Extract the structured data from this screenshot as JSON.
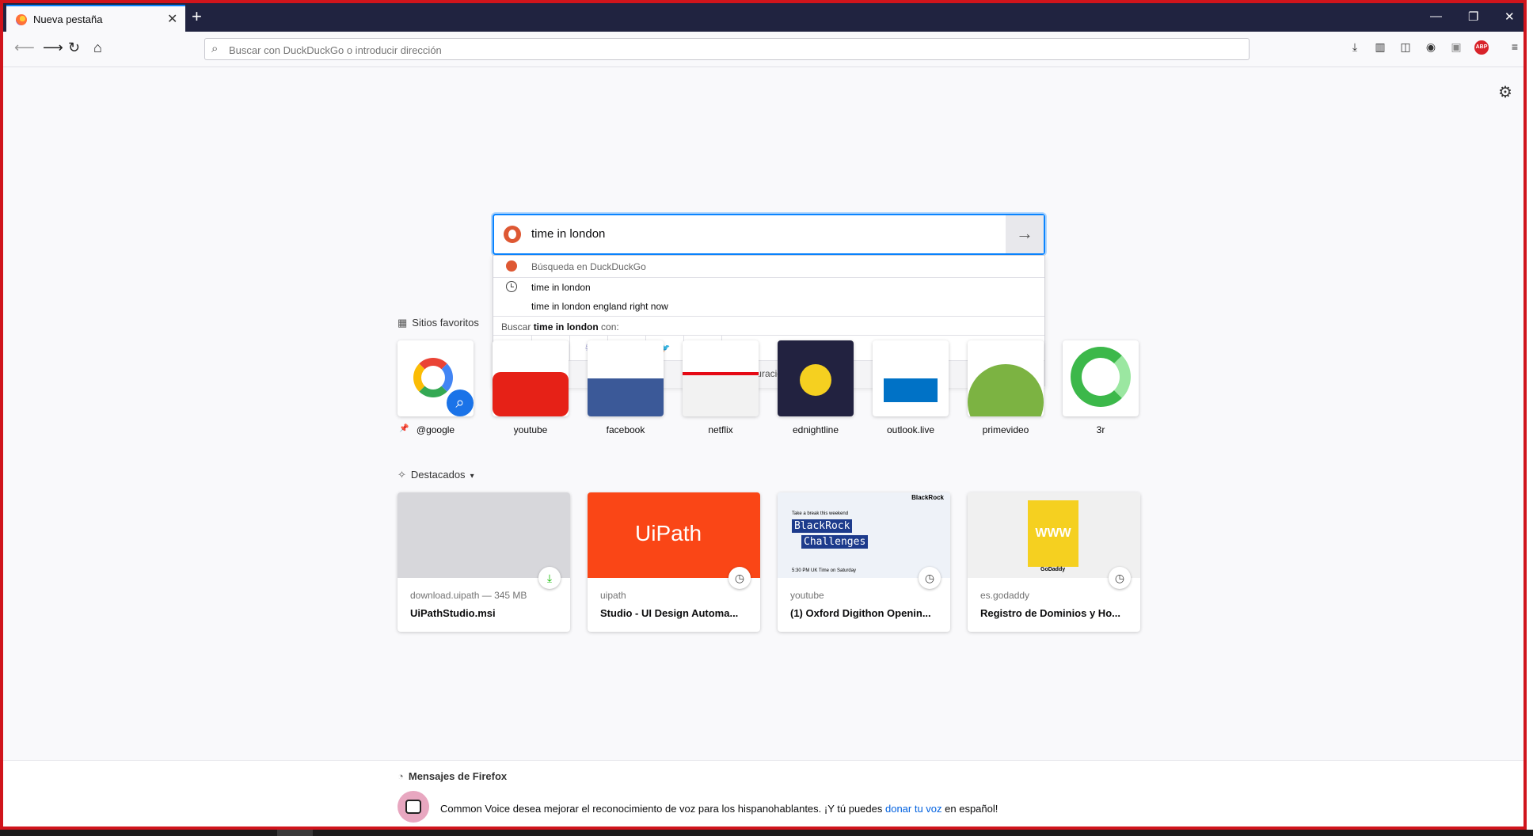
{
  "tab": {
    "title": "Nueva pestaña",
    "close": "✕",
    "new": "+"
  },
  "window_controls": {
    "minimize": "—",
    "restore": "❐",
    "close": "✕"
  },
  "toolbar": {
    "url_placeholder": "Buscar con DuckDuckGo o introducir dirección",
    "abp_label": "ABP"
  },
  "search": {
    "query": "time in london",
    "dropdown": {
      "header": "Búsqueda en DuckDuckGo",
      "suggestions": [
        "time in london",
        "time in london england right now"
      ],
      "search_with_prefix": "Buscar ",
      "search_with_query": "time in london",
      "search_with_suffix": " con:",
      "engines": [
        "G",
        "b",
        "♘",
        "ebay",
        "🐦",
        "W"
      ],
      "footer": "Cambiar configuración de búsqueda"
    }
  },
  "top_sites": {
    "label": "Sitios favoritos",
    "sites": [
      "@google",
      "youtube",
      "facebook",
      "netflix",
      "ednightline",
      "outlook.live",
      "primevideo",
      "3r"
    ]
  },
  "highlights": {
    "label": "Destacados",
    "cards": [
      {
        "host": "download.uipath — 345 MB",
        "title": "UiPathStudio.msi"
      },
      {
        "host": "uipath",
        "title": "Studio - UI Design Automa..."
      },
      {
        "host": "youtube",
        "title": "(1) Oxford Digithon Openin..."
      },
      {
        "host": "es.godaddy",
        "title": "Registro de Dominios y Ho..."
      }
    ],
    "thumbs": {
      "uipath_logo": "UiPath",
      "blackrock_brand": "BlackRock",
      "blackrock_line1": "BlackRock",
      "blackrock_line2": "Challenges",
      "blackrock_small": "Take a break this weekend",
      "blackrock_time": "5:30 PM UK Time on Saturday",
      "godaddy_brand": "GoDaddy",
      "godaddy_www": "WWW"
    }
  },
  "messages": {
    "title": "Mensajes de Firefox",
    "text_before": "Common Voice desea mejorar el reconocimiento de voz para los hispanohablantes. ¡Y tú puedes ",
    "link": "donar tu voz",
    "text_after": " en español!"
  }
}
